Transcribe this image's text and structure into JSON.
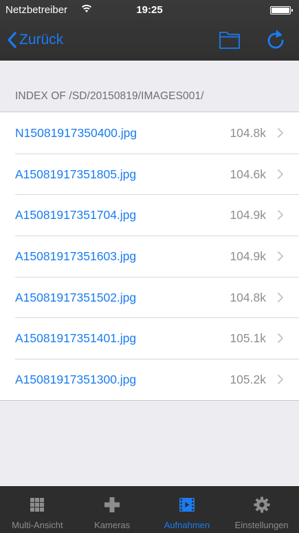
{
  "status": {
    "carrier": "Netzbetreiber",
    "time": "19:25",
    "wifi_icon": "wifi-icon",
    "battery_icon": "battery-icon"
  },
  "nav": {
    "back_label": "Zurück",
    "folder_icon": "folder-icon",
    "refresh_icon": "refresh-icon"
  },
  "colors": {
    "accent": "#1a7cf2",
    "bar": "#333333",
    "secondary_text": "#8e8e93",
    "tab_inactive": "#8d8d8d"
  },
  "section_header": "INDEX OF /SD/20150819/IMAGES001/",
  "files": [
    {
      "name": "N15081917350400.jpg",
      "size": "104.8k"
    },
    {
      "name": "A15081917351805.jpg",
      "size": "104.6k"
    },
    {
      "name": "A15081917351704.jpg",
      "size": "104.9k"
    },
    {
      "name": "A15081917351603.jpg",
      "size": "104.9k"
    },
    {
      "name": "A15081917351502.jpg",
      "size": "104.8k"
    },
    {
      "name": "A15081917351401.jpg",
      "size": "105.1k"
    },
    {
      "name": "A15081917351300.jpg",
      "size": "105.2k"
    }
  ],
  "tabs": [
    {
      "label": "Multi-Ansicht",
      "icon": "grid-icon",
      "active": false
    },
    {
      "label": "Kameras",
      "icon": "plus-icon",
      "active": false
    },
    {
      "label": "Aufnahmen",
      "icon": "film-icon",
      "active": true
    },
    {
      "label": "Einstellungen",
      "icon": "gear-icon",
      "active": false
    }
  ]
}
